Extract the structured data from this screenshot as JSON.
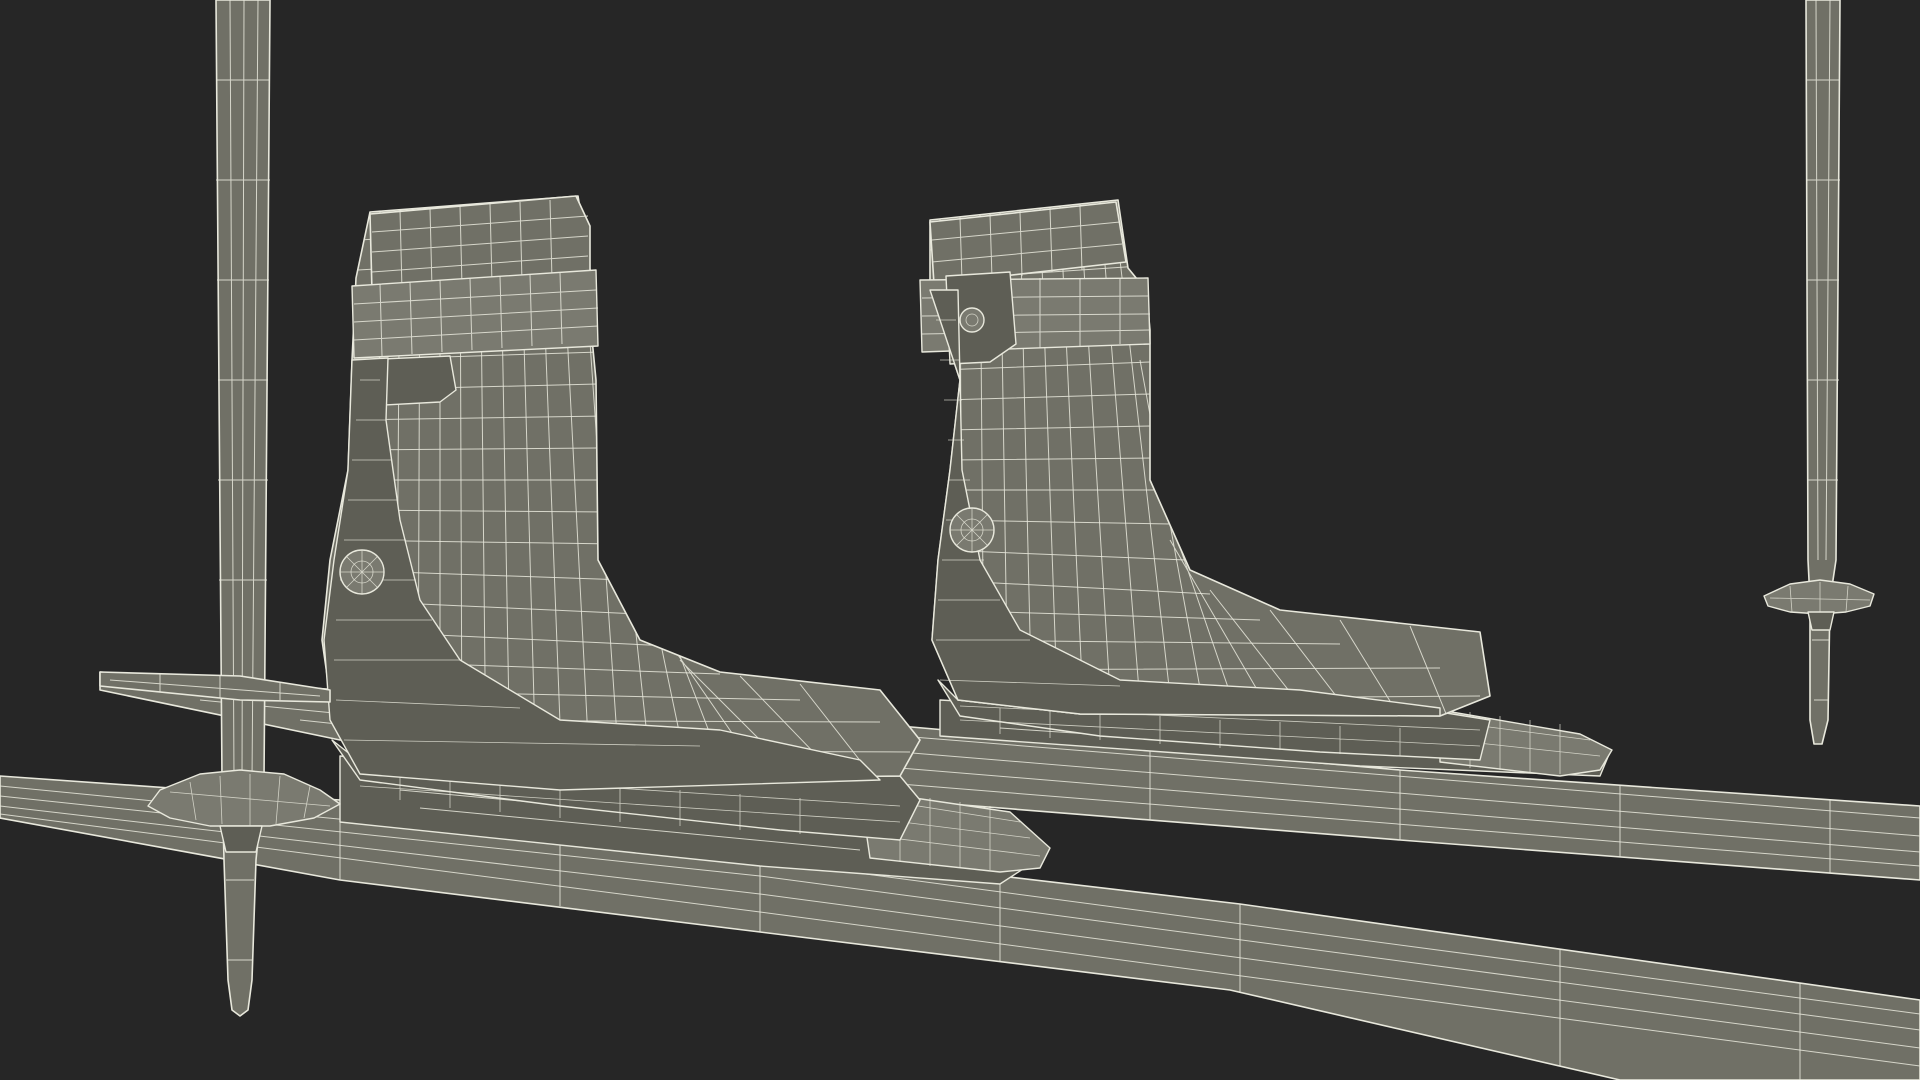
{
  "scene": {
    "description_visible_text": "",
    "background_color": "#262626",
    "mesh_fill_color": "#707066",
    "wire_color": "#e8e8dc",
    "render_style": "wireframe-over-shaded",
    "objects": [
      "left-ski",
      "right-ski",
      "left-boot",
      "right-boot",
      "left-pole",
      "right-pole"
    ]
  }
}
